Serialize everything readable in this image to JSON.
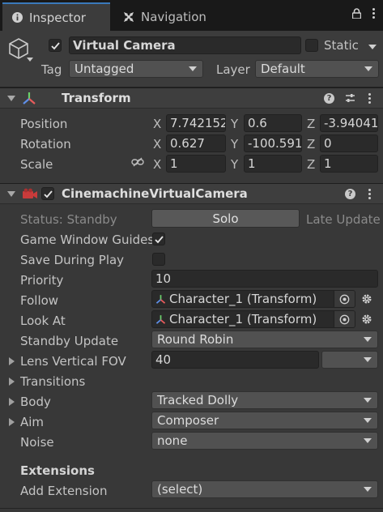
{
  "tabs": {
    "inspector": "Inspector",
    "navigation": "Navigation"
  },
  "header": {
    "object_name": "Virtual Camera",
    "static_label": "Static",
    "tag_label": "Tag",
    "tag_value": "Untagged",
    "layer_label": "Layer",
    "layer_value": "Default"
  },
  "transform": {
    "title": "Transform",
    "position_label": "Position",
    "rotation_label": "Rotation",
    "scale_label": "Scale",
    "x": "X",
    "y": "Y",
    "z": "Z",
    "position": {
      "x": "7.742152",
      "y": "0.6",
      "z": "-3.94041"
    },
    "rotation": {
      "x": "0.627",
      "y": "-100.591",
      "z": "0"
    },
    "scale": {
      "x": "1",
      "y": "1",
      "z": "1"
    }
  },
  "vcam": {
    "title": "CinemachineVirtualCamera",
    "status_label": "Status: Standby",
    "solo_label": "Solo",
    "late_update_label": "Late Update",
    "game_window_guides_label": "Game Window Guides",
    "save_during_play_label": "Save During Play",
    "priority_label": "Priority",
    "priority_value": "10",
    "follow_label": "Follow",
    "follow_value": "Character_1 (Transform)",
    "look_at_label": "Look At",
    "look_at_value": "Character_1 (Transform)",
    "standby_update_label": "Standby Update",
    "standby_update_value": "Round Robin",
    "lens_fov_label": "Lens Vertical FOV",
    "lens_fov_value": "40",
    "transitions_label": "Transitions",
    "body_label": "Body",
    "body_value": "Tracked Dolly",
    "aim_label": "Aim",
    "aim_value": "Composer",
    "noise_label": "Noise",
    "noise_value": "none",
    "extensions_label": "Extensions",
    "add_extension_label": "Add Extension",
    "add_extension_value": "(select)"
  },
  "colors": {
    "accent": "#3a79bb",
    "background": "#383838",
    "field_bg": "#2a2a2a"
  },
  "icons": {
    "inspector_tab": "info-icon",
    "navigation_tab": "navigation-icon",
    "lock": "lock-icon",
    "menu": "kebab-menu-icon",
    "gameobject": "cube-icon",
    "transform": "transform-axes-icon",
    "help": "help-icon",
    "presets": "sliders-icon",
    "scale_link": "chain-link-icon",
    "vcam": "camera-icon",
    "target": "target-icon",
    "gear": "gear-icon"
  }
}
